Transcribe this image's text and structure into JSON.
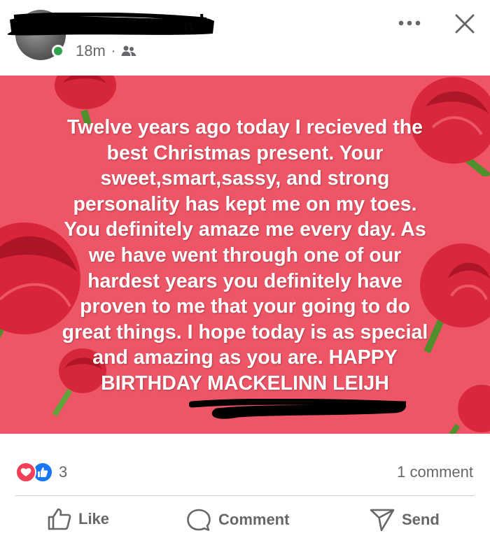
{
  "header": {
    "author_name_visible_fragment": "n",
    "timestamp": "18m",
    "separator": "·",
    "audience_icon": "friends-icon",
    "more_icon": "more-dots-icon",
    "close_icon": "close-icon"
  },
  "post": {
    "text": "Twelve years ago today I recieved the\nbest Christmas present. Your\nsweet,smart,sassy, and strong\npersonality has kept me on my toes.\nYou definitely amaze me every day. As\nwe have went through one of our\nhardest years you definitely have\nproven to me that your going to do\ngreat things. I hope today is as special\nand amazing as you are. HAPPY\nBIRTHDAY MACKELINN LEIJH",
    "background_color": "#ee5566"
  },
  "reactions": {
    "count": "3",
    "icons": [
      "love-icon",
      "like-icon"
    ],
    "comments_label": "1 comment"
  },
  "actions": {
    "like_label": "Like",
    "comment_label": "Comment",
    "send_label": "Send"
  },
  "colors": {
    "secondary_text": "#65676b",
    "like_blue": "#1877f2",
    "love_red": "#f33e58",
    "online_green": "#31a24c"
  }
}
